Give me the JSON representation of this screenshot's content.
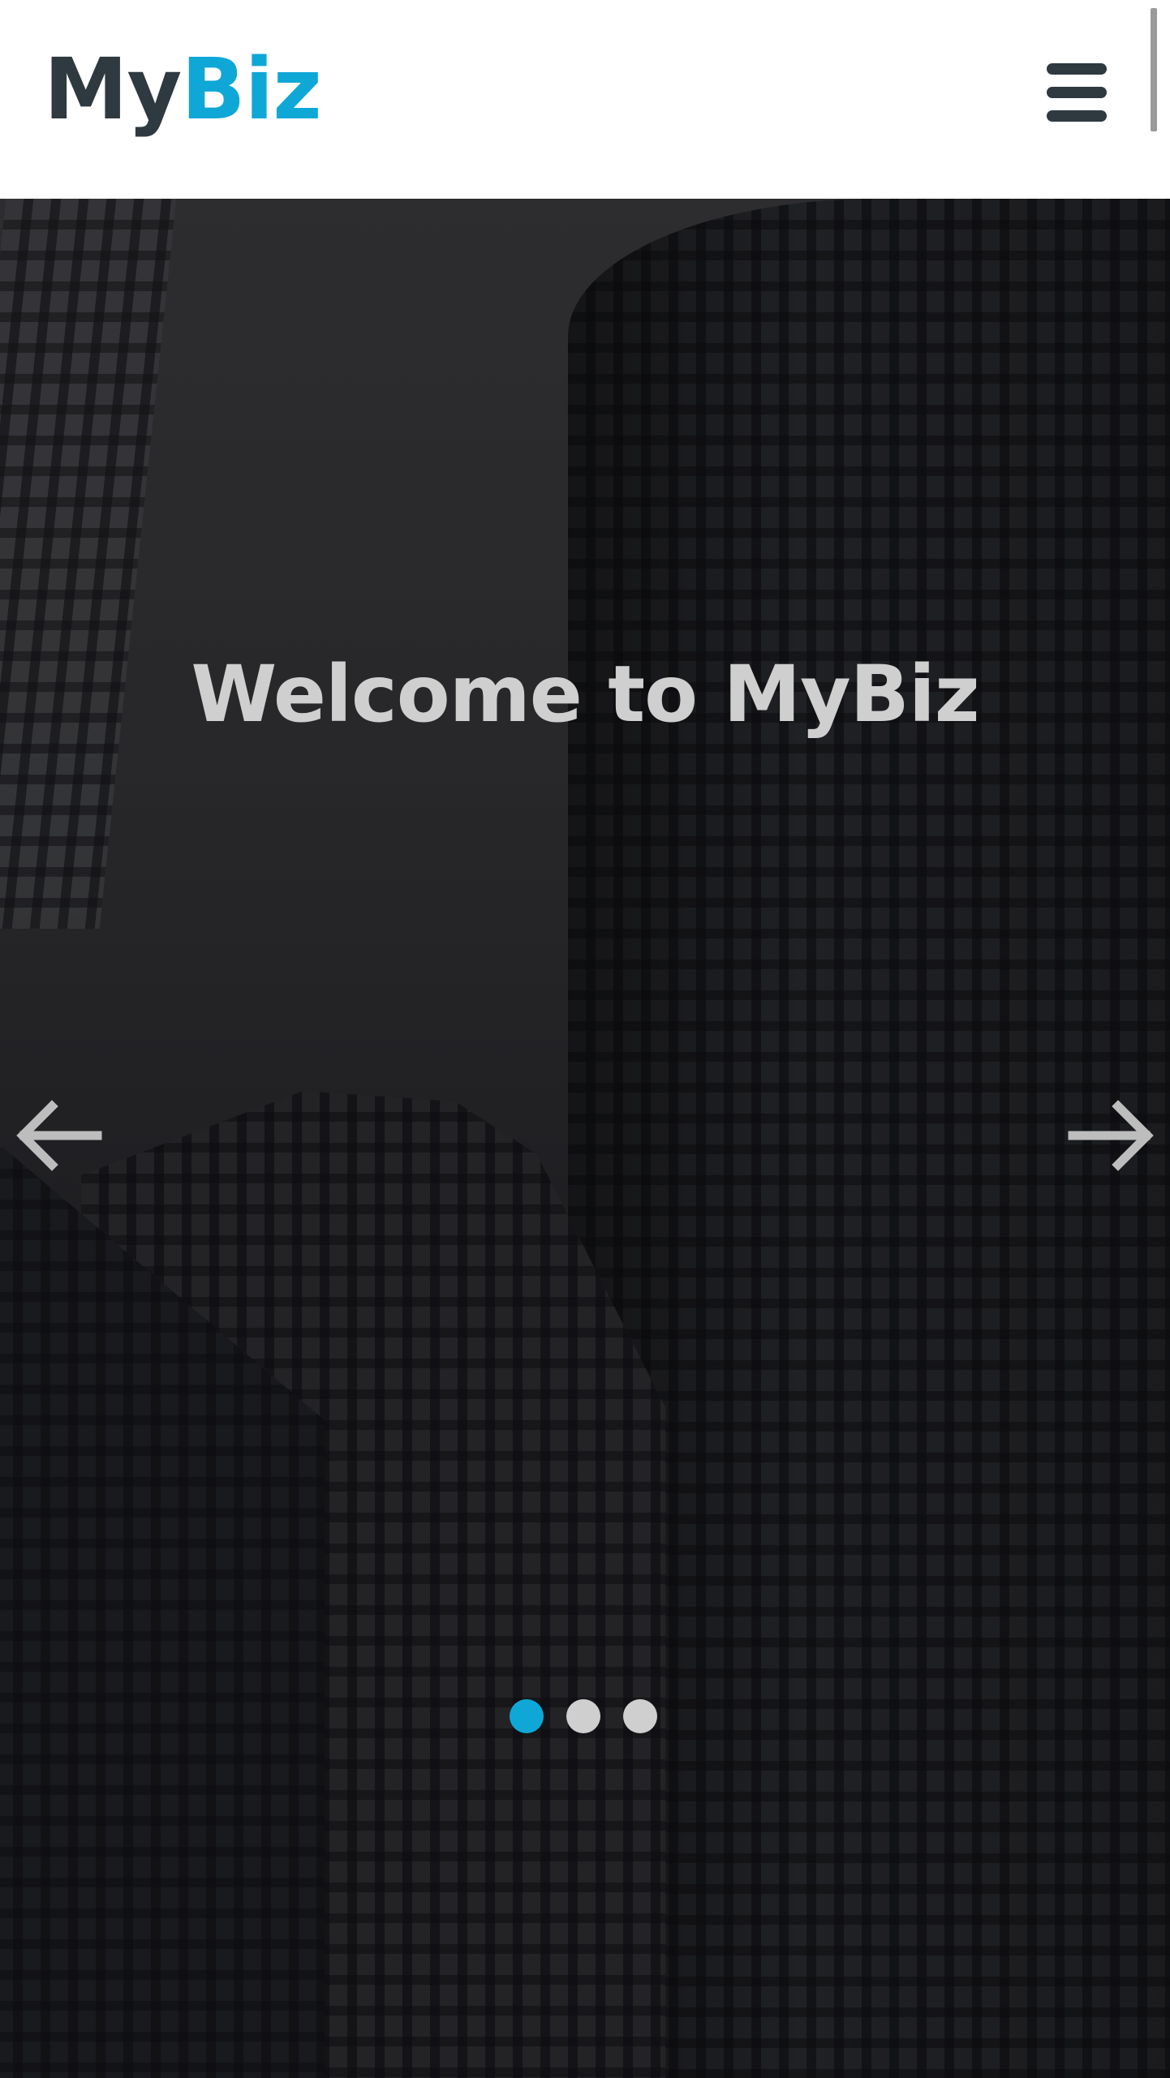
{
  "header": {
    "logo_part1": "My",
    "logo_part2": "Biz",
    "menu_icon": "hamburger-menu-icon"
  },
  "hero": {
    "title": "Welcome to MyBiz",
    "prev_icon": "arrow-left-icon",
    "next_icon": "arrow-right-icon",
    "slides_count": 3,
    "active_slide": 1
  },
  "colors": {
    "brand_dark": "#2e3940",
    "brand_accent": "#0fa7d6",
    "dot_inactive": "#cfcfcf",
    "hero_text": "#cfcfcf"
  }
}
